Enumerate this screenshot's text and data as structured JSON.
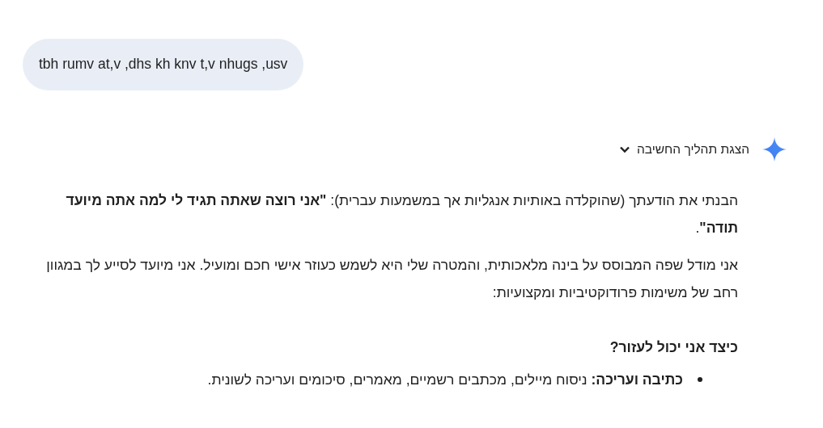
{
  "user_message": {
    "text": "tbh rumv at,v ,dhs kh knv t,v nhugs ,usv"
  },
  "thinking_toggle": {
    "label": "הצגת תהליך החשיבה",
    "expanded": false
  },
  "response": {
    "paragraphs": [
      "הבנתי את הודעתך (שהוקלדה באותיות אנגליות אך במשמעות עברית): **\"אני רוצה שאתה תגיד לי למה אתה מיועד תודה\"**.",
      "אני מודל שפה המבוסס על בינה מלאכותית, והמטרה שלי היא לשמש כעוזר אישי חכם ומועיל. אני מיועד לסייע לך במגוון רחב של משימות פרודוקטיביות ומקצועיות:"
    ],
    "heading": "כיצד אני יכול לעזור?",
    "bullets": [
      "**כתיבה ועריכה:** ניסוח מיילים, מכתבים רשמיים, מאמרים, סיכומים ועריכה לשונית."
    ]
  }
}
